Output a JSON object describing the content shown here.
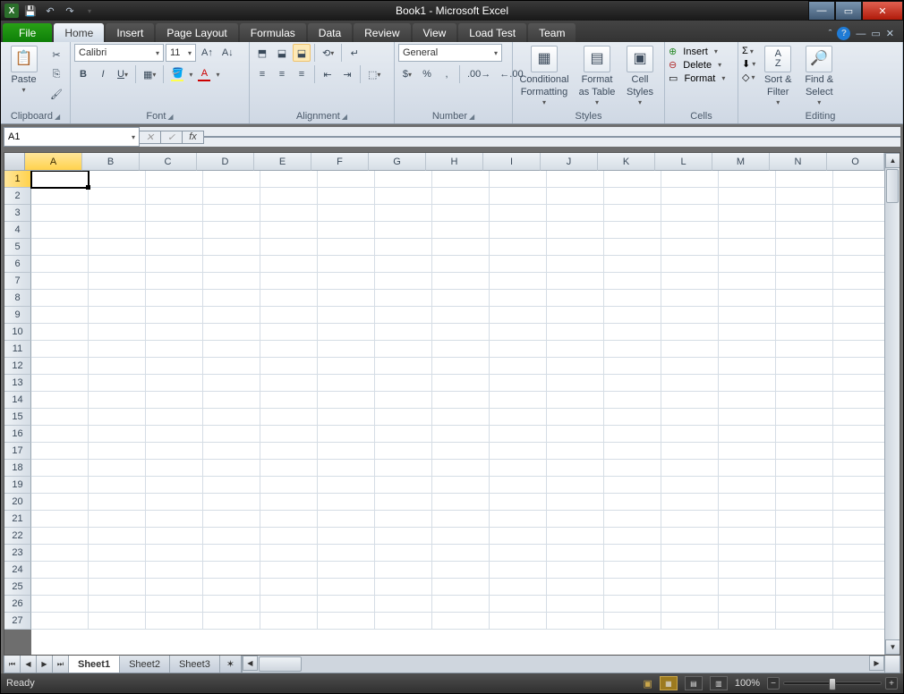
{
  "title": "Book1 - Microsoft Excel",
  "qat": {
    "app": "X"
  },
  "tabs": {
    "file": "File",
    "items": [
      "Home",
      "Insert",
      "Page Layout",
      "Formulas",
      "Data",
      "Review",
      "View",
      "Load Test",
      "Team"
    ],
    "active": "Home"
  },
  "ribbon": {
    "clipboard": {
      "label": "Clipboard",
      "paste": "Paste"
    },
    "font": {
      "label": "Font",
      "name": "Calibri",
      "size": "11"
    },
    "alignment": {
      "label": "Alignment"
    },
    "number": {
      "label": "Number",
      "format": "General"
    },
    "styles": {
      "label": "Styles",
      "cond1": "Conditional",
      "cond2": "Formatting",
      "fat1": "Format",
      "fat2": "as Table",
      "cs1": "Cell",
      "cs2": "Styles"
    },
    "cells": {
      "label": "Cells",
      "insert": "Insert",
      "delete": "Delete",
      "format": "Format"
    },
    "editing": {
      "label": "Editing",
      "sf1": "Sort &",
      "sf2": "Filter",
      "fs1": "Find &",
      "fs2": "Select"
    }
  },
  "namebox": "A1",
  "columns": [
    "A",
    "B",
    "C",
    "D",
    "E",
    "F",
    "G",
    "H",
    "I",
    "J",
    "K",
    "L",
    "M",
    "N",
    "O"
  ],
  "rows": [
    "1",
    "2",
    "3",
    "4",
    "5",
    "6",
    "7",
    "8",
    "9",
    "10",
    "11",
    "12",
    "13",
    "14",
    "15",
    "16",
    "17",
    "18",
    "19",
    "20",
    "21",
    "22",
    "23",
    "24",
    "25",
    "26",
    "27"
  ],
  "sheets": [
    "Sheet1",
    "Sheet2",
    "Sheet3"
  ],
  "status": {
    "ready": "Ready",
    "zoom": "100%"
  }
}
